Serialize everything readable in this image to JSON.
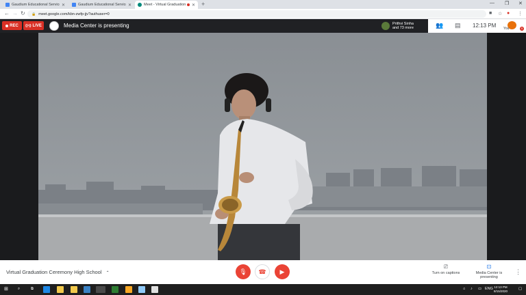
{
  "browser": {
    "tabs": [
      {
        "title": "Gaudium Educational Services Hi",
        "favicon_color": "#4285f4",
        "active": false
      },
      {
        "title": "Gaudium Educational Services Hi",
        "favicon_color": "#4285f4",
        "active": false
      },
      {
        "title": "Meet - Virtual Graduation Ce",
        "favicon_color": "#00897b",
        "active": true
      }
    ],
    "new_tab": "+",
    "url": "meet.google.com/kbn-zwfp-jjv?authuser=0"
  },
  "meet": {
    "rec_label": "REC",
    "live_label": "LIVE",
    "presenter_text": "Media Center is presenting",
    "participants": {
      "name": "Prithvi Sinha",
      "more": "and 73 more"
    },
    "clock": "12:13 PM",
    "self_label": "You",
    "self_badge": "5",
    "meeting_title": "Virtual Graduation Ceremony High School",
    "actions": [
      {
        "label": "Turn on captions",
        "icon": "captions-icon"
      },
      {
        "label": "Media Center is presenting",
        "icon": "presenting-icon"
      }
    ],
    "accent_red": "#ea4335"
  },
  "taskbar": {
    "language": "ENG",
    "time": "12:13 PM",
    "date": "8/15/2020"
  }
}
